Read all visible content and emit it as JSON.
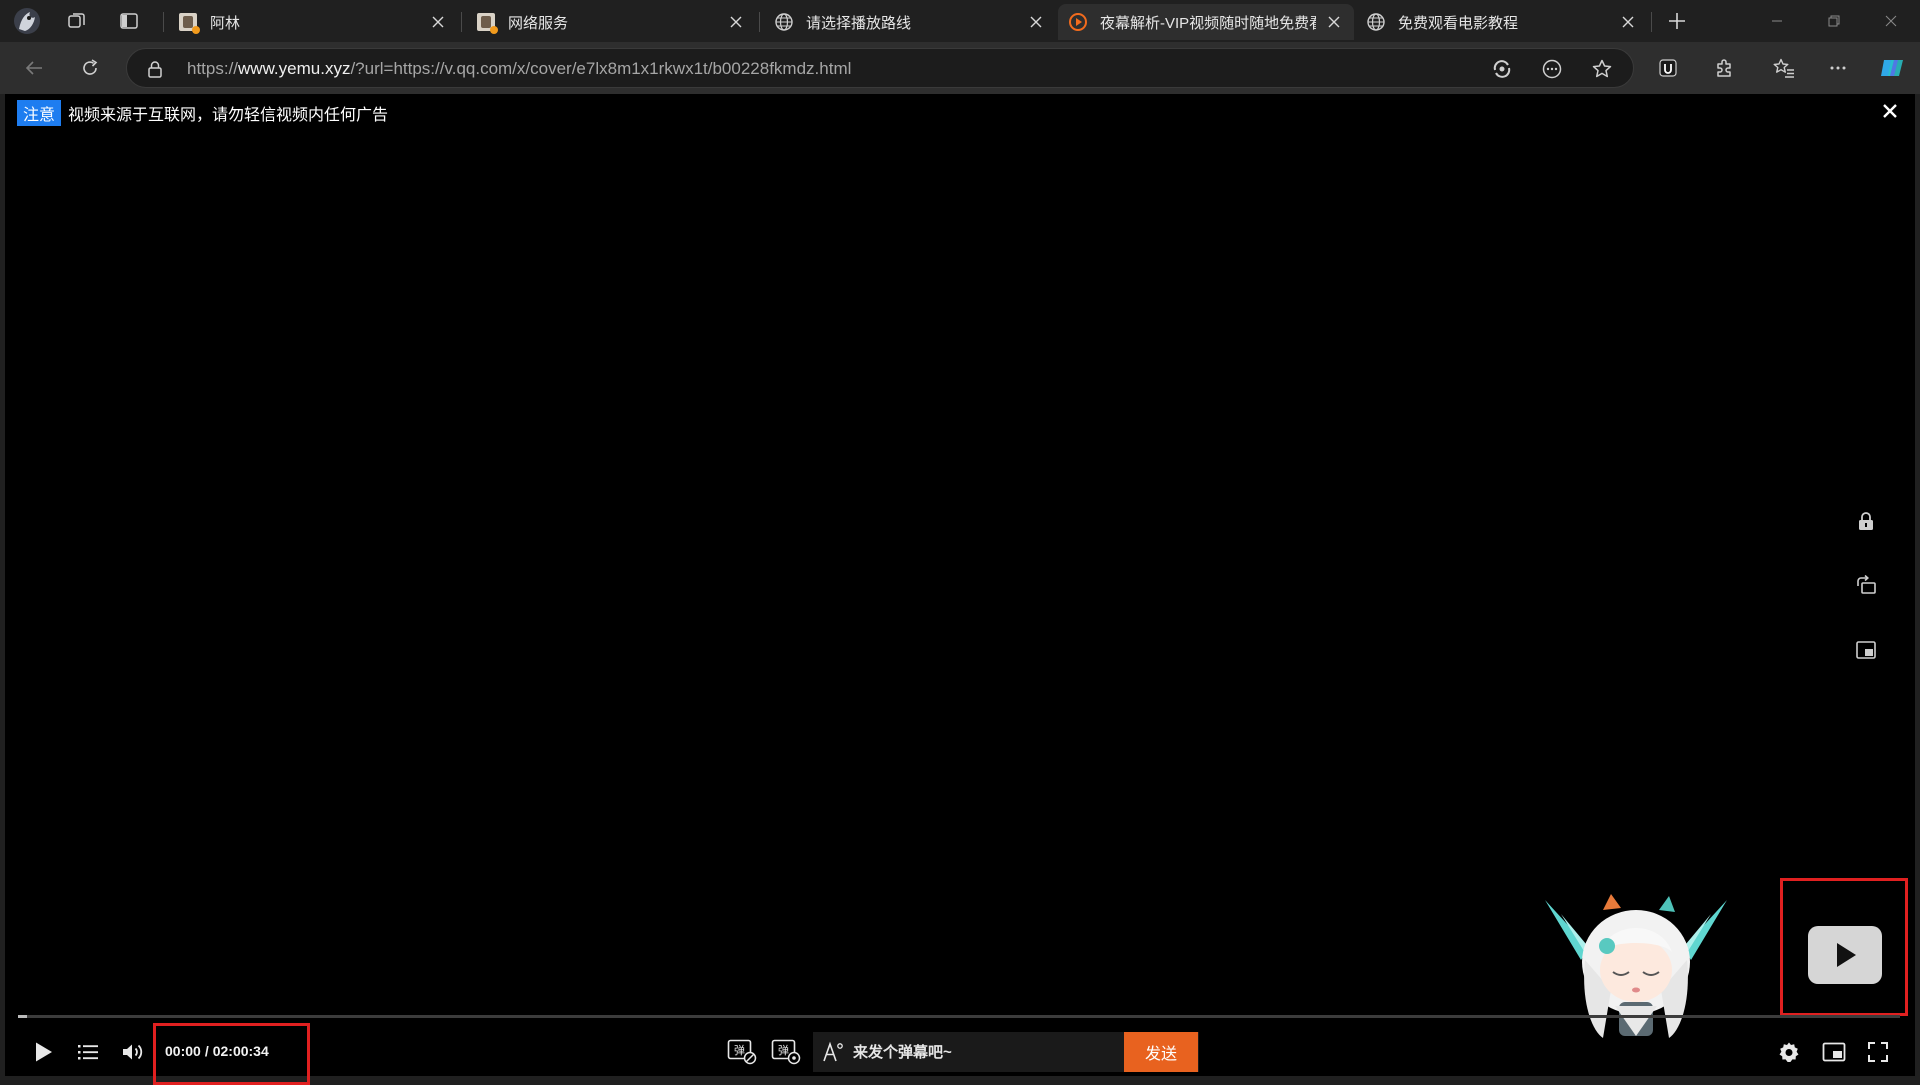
{
  "tabs": [
    {
      "title": "阿林",
      "active": false,
      "favicon": "profile-image-icon"
    },
    {
      "title": "网络服务",
      "active": false,
      "favicon": "profile-image-icon"
    },
    {
      "title": "请选择播放路线",
      "active": false,
      "favicon": "globe-icon"
    },
    {
      "title": "夜幕解析-VIP视频随时随地免费看",
      "active": true,
      "favicon": "play-circle-icon"
    },
    {
      "title": "免费观看电影教程",
      "active": false,
      "favicon": "globe-icon"
    }
  ],
  "address": {
    "scheme": "https://",
    "host": "www.yemu.xyz",
    "path": "/?url=https://v.qq.com/x/cover/e7lx8m1x1rkwx1t/b00228fkmdz.html"
  },
  "notice": {
    "tag": "注意",
    "text": "视频来源于互联网，请勿轻信视频内任何广告"
  },
  "player": {
    "current_time": "00:00",
    "separator": "/",
    "duration": "02:00:34",
    "progress_fraction": 0.005,
    "danmaku_placeholder": "来发个弹幕吧~",
    "send_label": "发送"
  },
  "colors": {
    "accent_blue": "#1e7df0",
    "send_orange": "#e8621f",
    "highlight_red": "#e02020"
  }
}
